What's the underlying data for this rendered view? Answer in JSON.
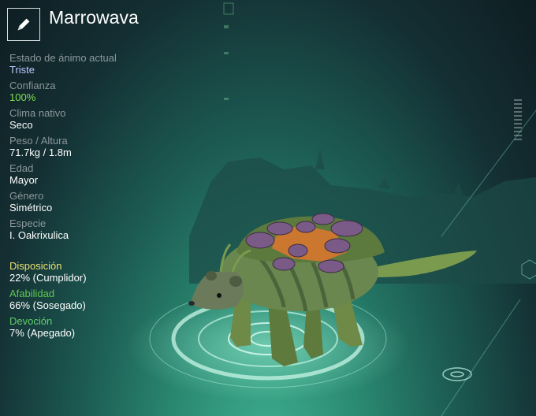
{
  "creature": {
    "name": "Marrowava"
  },
  "stats": [
    {
      "label": "Estado de ánimo actual",
      "value": "Triste",
      "value_color": "#b8c9ff"
    },
    {
      "label": "Confianza",
      "value": "100%",
      "value_color": "#80e050"
    },
    {
      "label": "Clima nativo",
      "value": "Seco",
      "value_color": "#ffffff"
    },
    {
      "label": "Peso / Altura",
      "value": "71.7kg / 1.8m",
      "value_color": "#ffffff"
    },
    {
      "label": "Edad",
      "value": "Mayor",
      "value_color": "#ffffff"
    },
    {
      "label": "Género",
      "value": "Simétrico",
      "value_color": "#ffffff"
    },
    {
      "label": "Especie",
      "value": "I. Oakrixulica",
      "value_color": "#ffffff"
    }
  ],
  "traits": [
    {
      "label": "Disposición",
      "value": "22% (Cumplidor)",
      "label_color": "#e8e070"
    },
    {
      "label": "Afabilidad",
      "value": "66% (Sosegado)",
      "label_color": "#60c850"
    },
    {
      "label": "Devoción",
      "value": "7% (Apegado)",
      "label_color": "#5fcf6a"
    }
  ],
  "icons": {
    "edit": "pencil-icon"
  }
}
